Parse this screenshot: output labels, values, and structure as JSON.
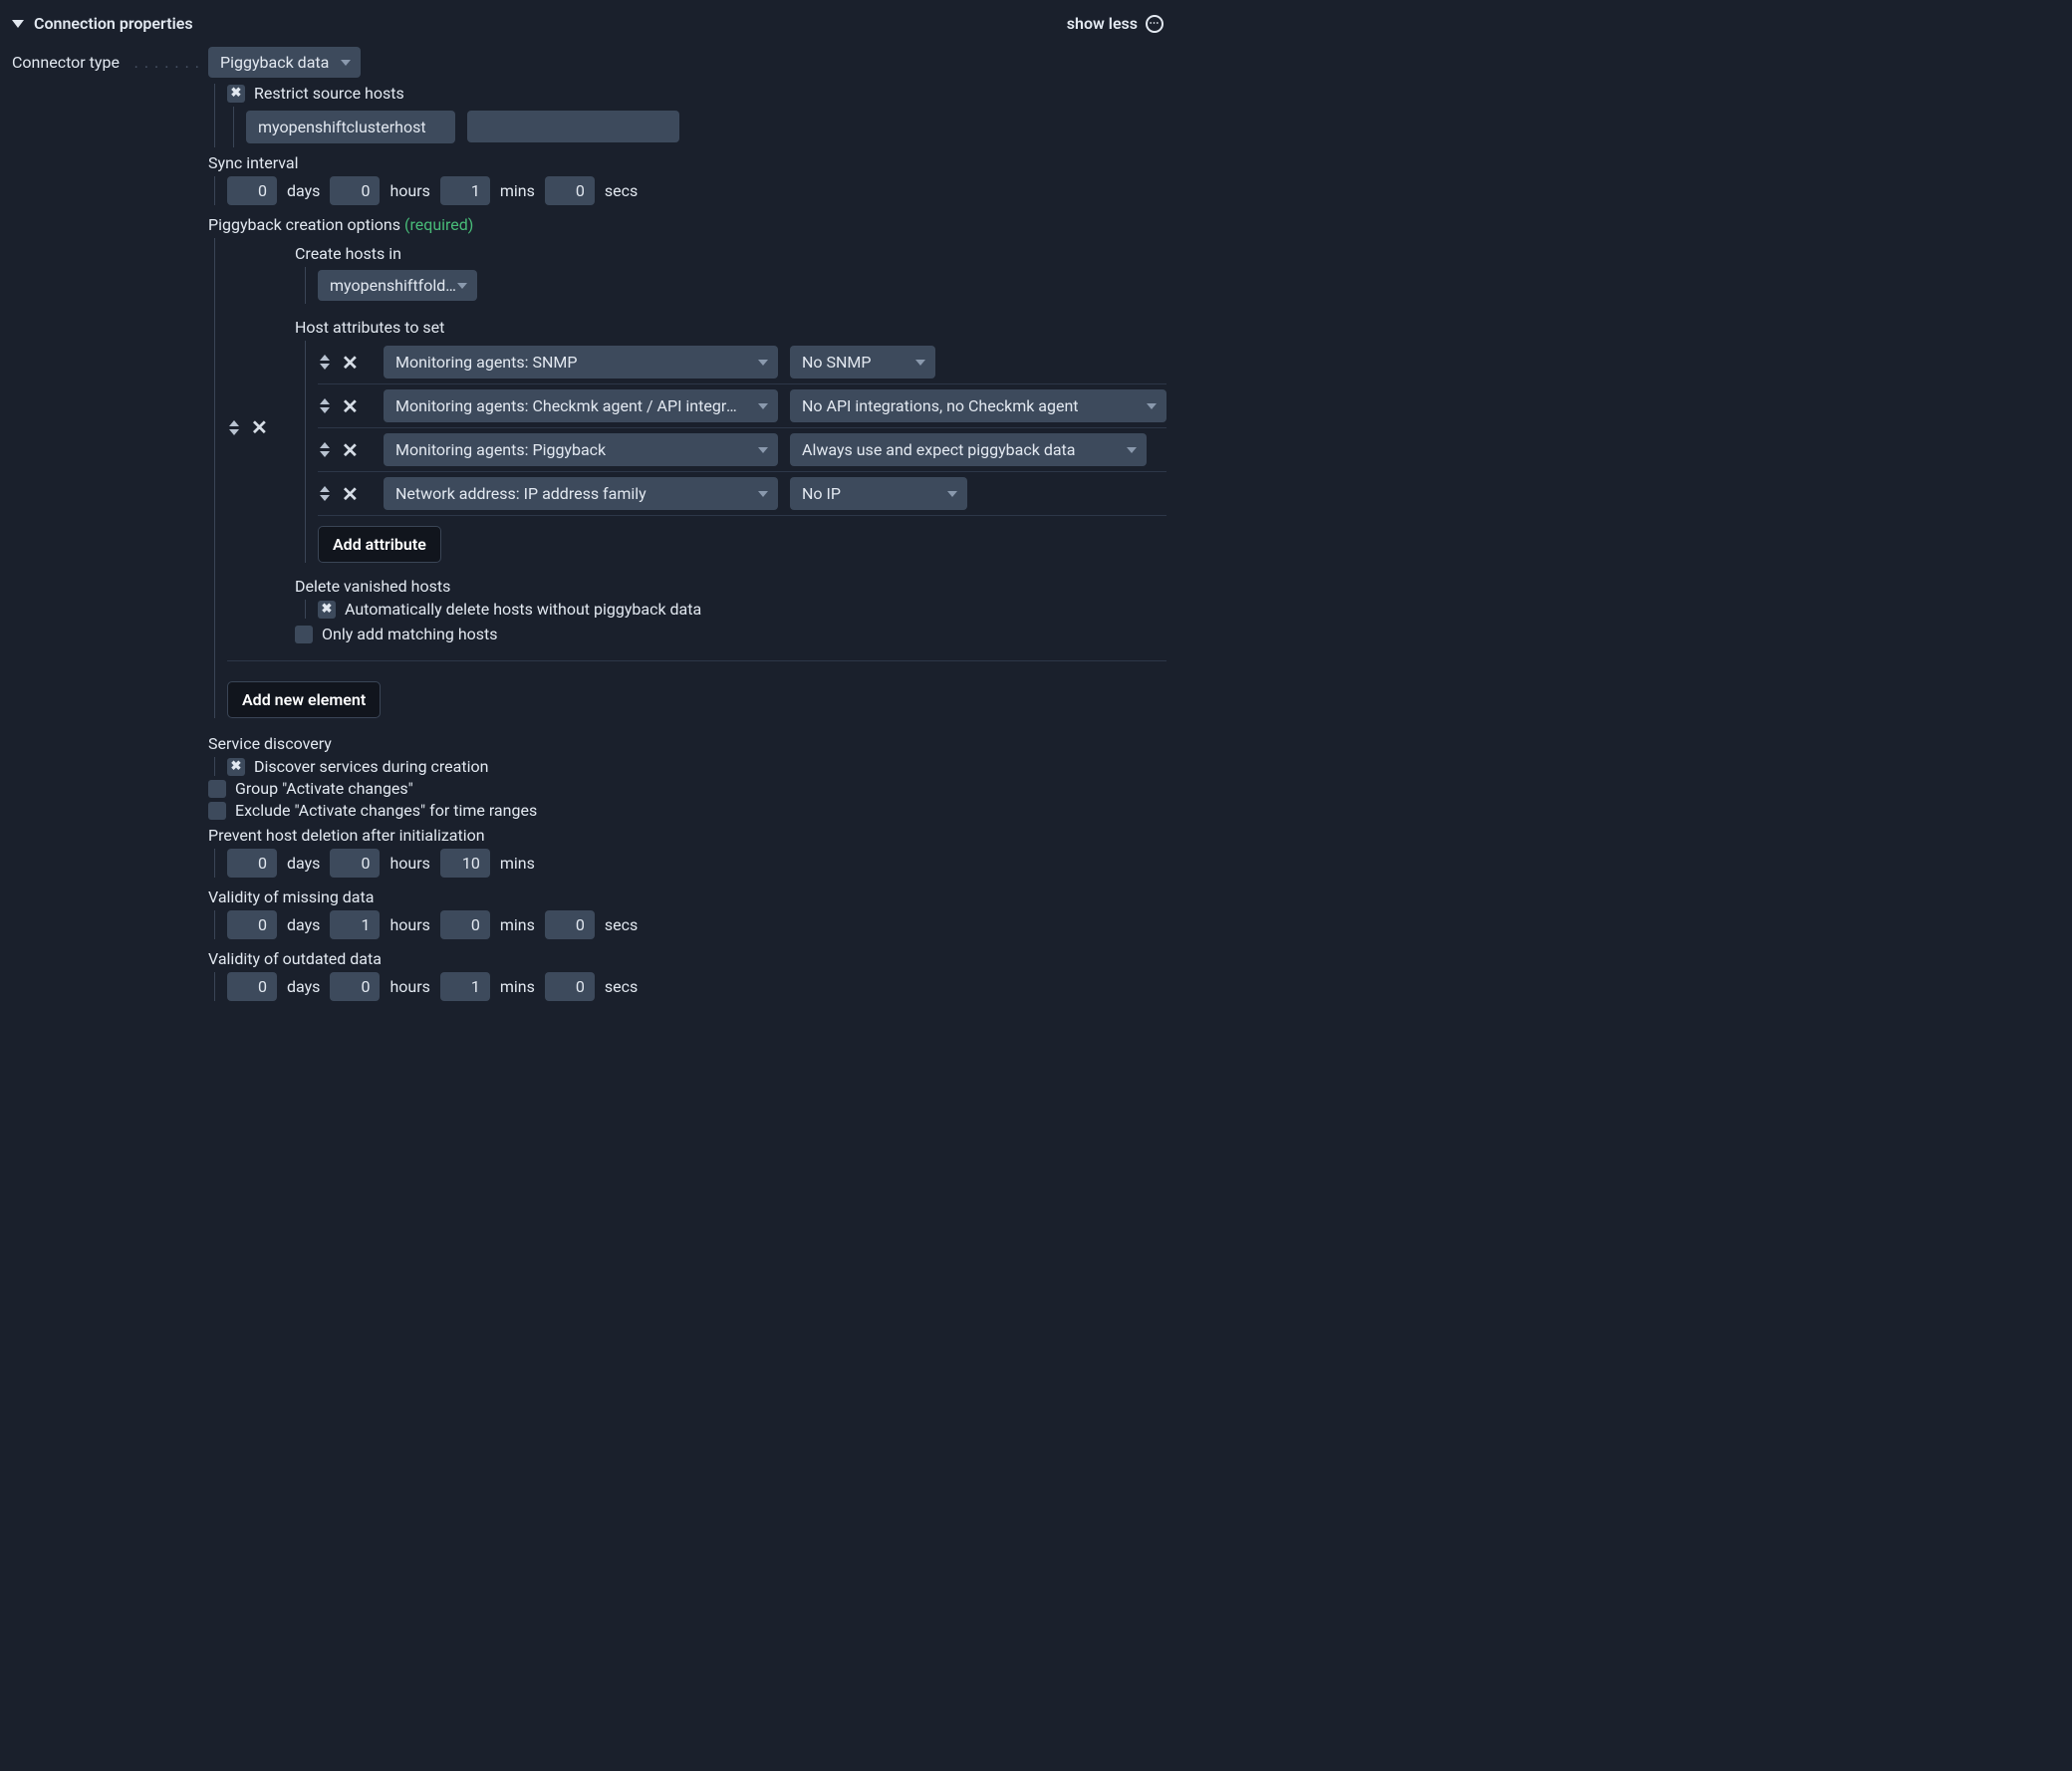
{
  "header": {
    "title": "Connection properties",
    "show_less": "show less"
  },
  "connector": {
    "label": "Connector type",
    "value": "Piggyback data",
    "restrict_label": "Restrict source hosts",
    "source_host": "myopenshiftclusterhost"
  },
  "sync": {
    "label": "Sync interval",
    "days": "0",
    "hours": "0",
    "mins": "1",
    "secs": "0",
    "u_days": "days",
    "u_hours": "hours",
    "u_mins": "mins",
    "u_secs": "secs"
  },
  "piggyback": {
    "label": "Piggyback creation options",
    "required": "(required)",
    "create_in_label": "Create hosts in",
    "create_in_value": "myopenshiftfold…",
    "attrs_label": "Host attributes to set",
    "attrs": [
      {
        "key": "Monitoring agents: SNMP",
        "val": "No SNMP",
        "kw": 396,
        "vw": 146
      },
      {
        "key": "Monitoring agents: Checkmk agent / API integra…",
        "val": "No API integrations, no Checkmk agent",
        "kw": 396,
        "vw": 378
      },
      {
        "key": "Monitoring agents: Piggyback",
        "val": "Always use and expect piggyback data",
        "kw": 396,
        "vw": 358
      },
      {
        "key": "Network address: IP address family",
        "val": "No IP",
        "kw": 396,
        "vw": 178
      }
    ],
    "add_attr": "Add attribute",
    "delete_label": "Delete vanished hosts",
    "delete_opt": "Automatically delete hosts without piggyback data",
    "only_add": "Only add matching hosts",
    "add_elem": "Add new element"
  },
  "discovery": {
    "label": "Service discovery",
    "discover": "Discover services during creation",
    "group": "Group \"Activate changes\"",
    "exclude": "Exclude \"Activate changes\" for time ranges"
  },
  "prevent": {
    "label": "Prevent host deletion after initialization",
    "days": "0",
    "hours": "0",
    "mins": "10",
    "u_days": "days",
    "u_hours": "hours",
    "u_mins": "mins"
  },
  "validity_missing": {
    "label": "Validity of missing data",
    "days": "0",
    "hours": "1",
    "mins": "0",
    "secs": "0",
    "u_days": "days",
    "u_hours": "hours",
    "u_mins": "mins",
    "u_secs": "secs"
  },
  "validity_outdated": {
    "label": "Validity of outdated data",
    "days": "0",
    "hours": "0",
    "mins": "1",
    "secs": "0",
    "u_days": "days",
    "u_hours": "hours",
    "u_mins": "mins",
    "u_secs": "secs"
  }
}
